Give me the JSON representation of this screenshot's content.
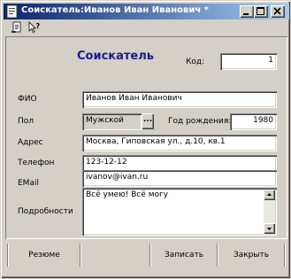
{
  "window": {
    "title": "Соискатель:Иванов Иван Иванович *",
    "title_bar_colors": {
      "start": "#0a246a",
      "end": "#a6caf0"
    },
    "controls": {
      "minimize_icon": "minimize-icon",
      "maximize_icon": "maximize-icon",
      "close_icon": "close-icon"
    }
  },
  "toolbar": {
    "items": [
      {
        "icon": "document-properties-icon"
      },
      {
        "icon": "help-cursor-icon"
      }
    ]
  },
  "form": {
    "heading": "Соискатель",
    "code_label": "Код:",
    "code_value": "1",
    "fio_label": "ФИО",
    "fio_value": "Иванов Иван Иванович",
    "gender_label": "Пол",
    "gender_value": "Мужской",
    "gender_button": "...",
    "birth_year_label": "Год рождения:",
    "birth_year_value": "1980",
    "address_label": "Адрес",
    "address_value": "Москва, Гиповская ул., д.10, кв.1",
    "phone_label": "Телефон",
    "phone_value": "123-12-12",
    "email_label": "EMail",
    "email_value": "ivanov@ivan.ru",
    "details_label": "Подробности",
    "details_value": "Всё умею! Всё могу"
  },
  "footer": {
    "resume_label": "Резюме",
    "save_label": "Записать",
    "close_label": "Закрыть"
  },
  "colors": {
    "face": "#d4d0c8",
    "heading": "#1b1b84",
    "field_bg": "#ffffff"
  }
}
